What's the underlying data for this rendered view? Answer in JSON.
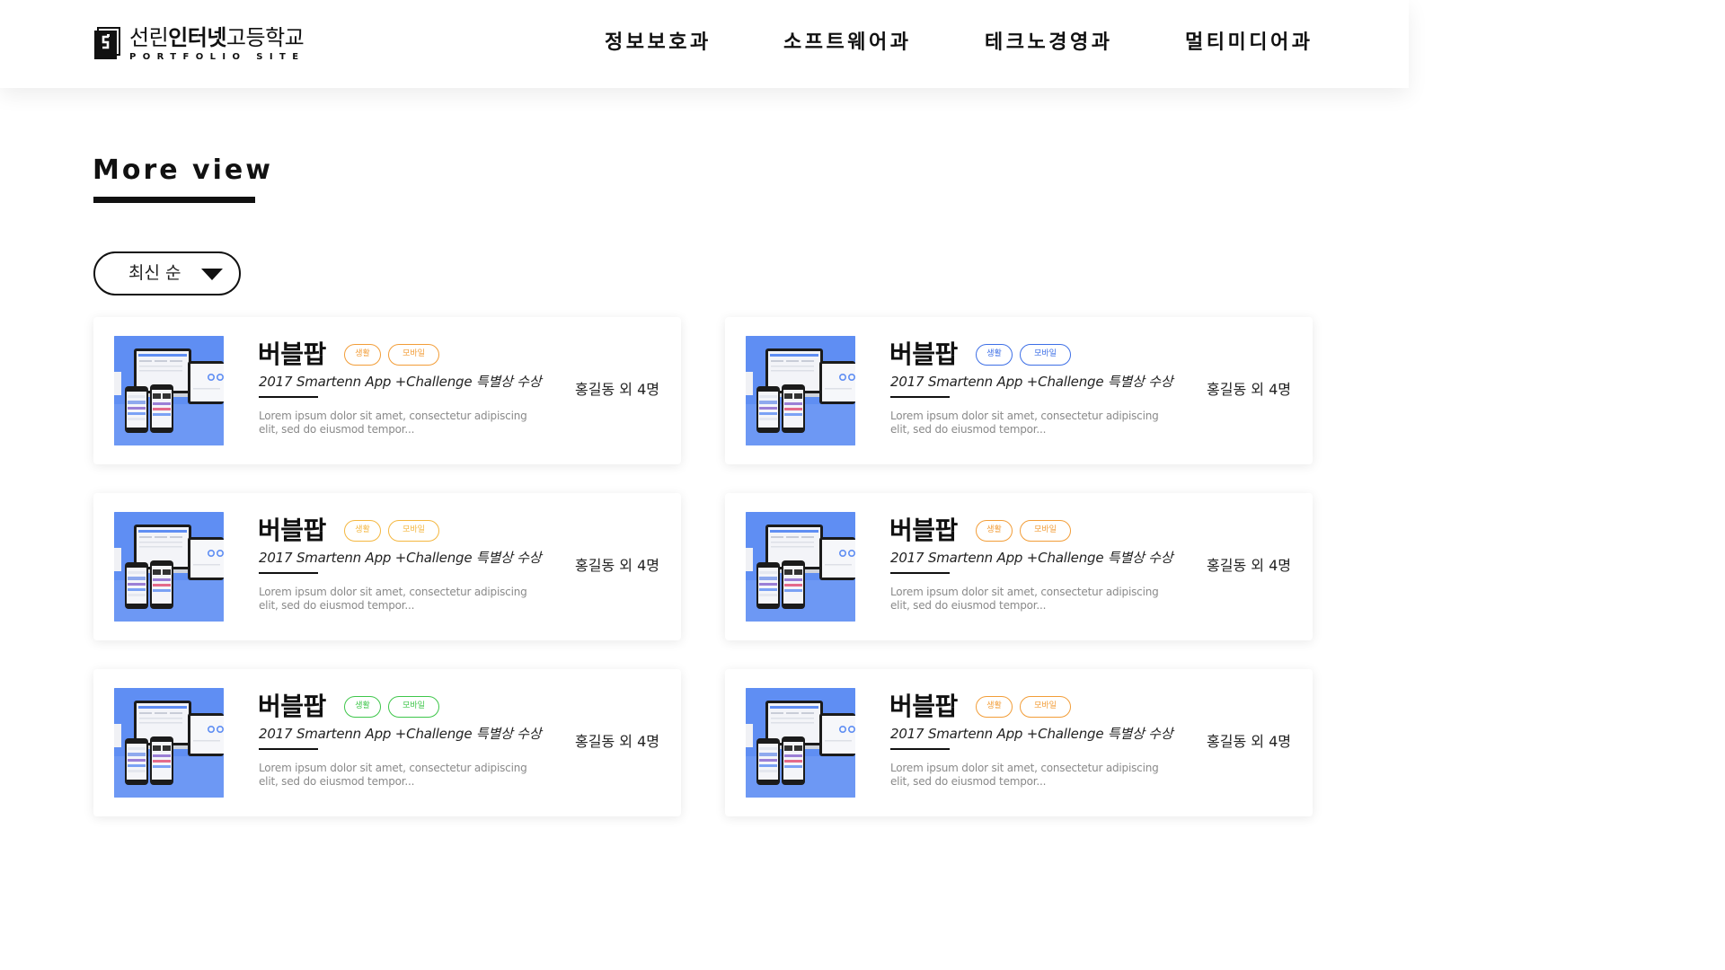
{
  "header": {
    "logo_ko_light1": "선린",
    "logo_ko_bold": "인터넷",
    "logo_ko_light2": "고등학교",
    "logo_en": "PORTFOLIO SITE",
    "nav": [
      "정보보호과",
      "소프트웨어과",
      "테크노경영과",
      "멀티미디어과"
    ]
  },
  "section": {
    "title": "More view"
  },
  "sort": {
    "label": "최신 순",
    "icon": "caret-down-icon"
  },
  "colors": {
    "orange": "#f29d38",
    "yellow": "#f4b740",
    "blue": "#3d6fe6",
    "green": "#3ec64a",
    "thumb_bg": "#5f8ef3"
  },
  "cards": [
    {
      "title": "버블팝",
      "tags": [
        "생활",
        "모바일"
      ],
      "tag_color": "orange",
      "subtitle": "2017 Smartenn App +Challenge 특별상 수상",
      "desc": "Lorem ipsum dolor sit amet, consectetur adipiscing elit, sed do eiusmod tempor...",
      "author": "홍길동 외 4명"
    },
    {
      "title": "버블팝",
      "tags": [
        "생활",
        "모바일"
      ],
      "tag_color": "blue",
      "subtitle": "2017 Smartenn App +Challenge 특별상 수상",
      "desc": "Lorem ipsum dolor sit amet, consectetur adipiscing elit, sed do eiusmod tempor...",
      "author": "홍길동 외 4명"
    },
    {
      "title": "버블팝",
      "tags": [
        "생활",
        "모바일"
      ],
      "tag_color": "yellow",
      "subtitle": "2017 Smartenn App +Challenge 특별상 수상",
      "desc": "Lorem ipsum dolor sit amet, consectetur adipiscing elit, sed do eiusmod tempor...",
      "author": "홍길동 외 4명"
    },
    {
      "title": "버블팝",
      "tags": [
        "생활",
        "모바일"
      ],
      "tag_color": "orange",
      "subtitle": "2017 Smartenn App +Challenge 특별상 수상",
      "desc": "Lorem ipsum dolor sit amet, consectetur adipiscing elit, sed do eiusmod tempor...",
      "author": "홍길동 외 4명"
    },
    {
      "title": "버블팝",
      "tags": [
        "생활",
        "모바일"
      ],
      "tag_color": "green",
      "subtitle": "2017 Smartenn App +Challenge 특별상 수상",
      "desc": "Lorem ipsum dolor sit amet, consectetur adipiscing elit, sed do eiusmod tempor...",
      "author": "홍길동 외 4명"
    },
    {
      "title": "버블팝",
      "tags": [
        "생활",
        "모바일"
      ],
      "tag_color": "orange",
      "subtitle": "2017 Smartenn App +Challenge 특별상 수상",
      "desc": "Lorem ipsum dolor sit amet, consectetur adipiscing elit, sed do eiusmod tempor...",
      "author": "홍길동 외 4명"
    }
  ]
}
